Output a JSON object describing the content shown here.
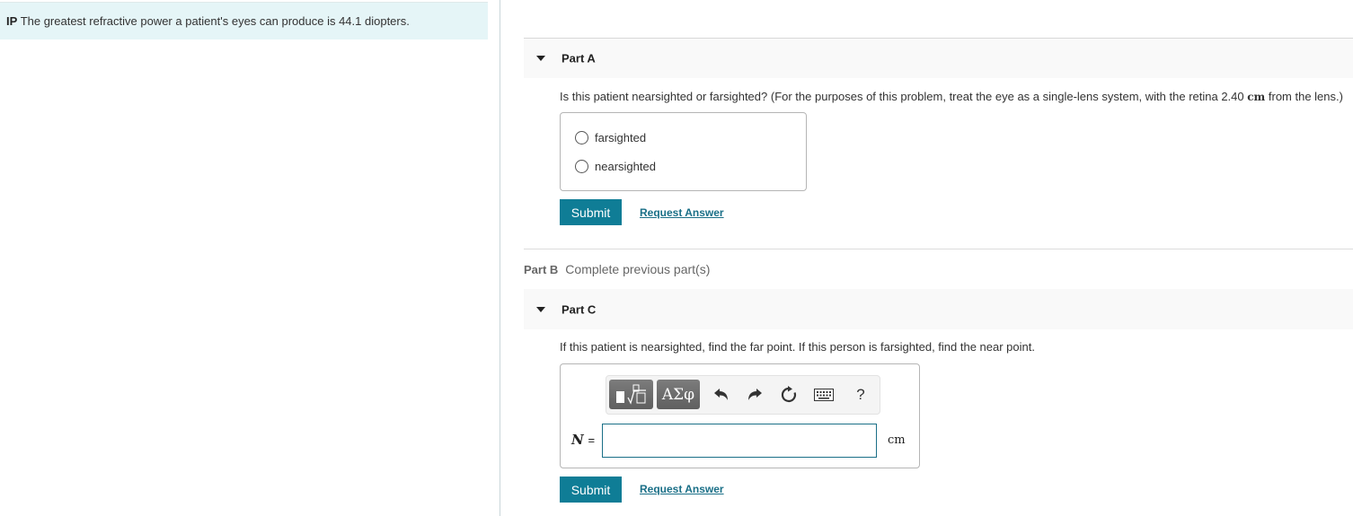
{
  "intro": {
    "prefix": "IP",
    "text": "The greatest refractive power a patient's eyes can produce is 44.1 diopters."
  },
  "part_a": {
    "title": "Part A",
    "question_before": "Is this patient nearsighted or farsighted? (For the purposes of this problem, treat the eye as a single-lens system, with the retina 2.40 ",
    "question_unit": "cm",
    "question_after": " from the lens.)",
    "options": [
      {
        "label": "farsighted",
        "selected": false
      },
      {
        "label": "nearsighted",
        "selected": false
      }
    ],
    "submit_label": "Submit",
    "request_answer_label": "Request Answer"
  },
  "part_b": {
    "title": "Part B",
    "status": "Complete previous part(s)"
  },
  "part_c": {
    "title": "Part C",
    "question": "If this patient is nearsighted, find the far point. If this person is farsighted, find the near point.",
    "toolbar": {
      "templates_icon": "templates-icon",
      "symbols_label": "ΑΣφ",
      "undo_icon": "undo-icon",
      "redo_icon": "redo-icon",
      "reset_icon": "reset-icon",
      "keyboard_icon": "keyboard-icon",
      "help_label": "?"
    },
    "variable": "N",
    "equals": "=",
    "answer_value": "",
    "unit": "cm",
    "submit_label": "Submit",
    "request_answer_label": "Request Answer"
  }
}
